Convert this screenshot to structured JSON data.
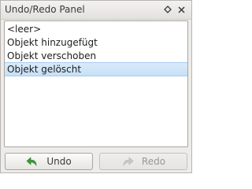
{
  "window": {
    "title": "Undo/Redo Panel",
    "float_icon": "float-diamond-icon",
    "close_icon": "close-icon"
  },
  "history": {
    "items": [
      {
        "label": "<leer>",
        "selected": false
      },
      {
        "label": "Objekt hinzugefügt",
        "selected": false
      },
      {
        "label": "Objekt verschoben",
        "selected": false
      },
      {
        "label": "Objekt gelöscht",
        "selected": true
      }
    ]
  },
  "buttons": {
    "undo": {
      "label": "Undo",
      "icon": "undo-arrow-icon",
      "enabled": true,
      "icon_color": "#3a9a3a"
    },
    "redo": {
      "label": "Redo",
      "icon": "redo-arrow-icon",
      "enabled": false,
      "icon_color": "#b5b3b0"
    }
  }
}
